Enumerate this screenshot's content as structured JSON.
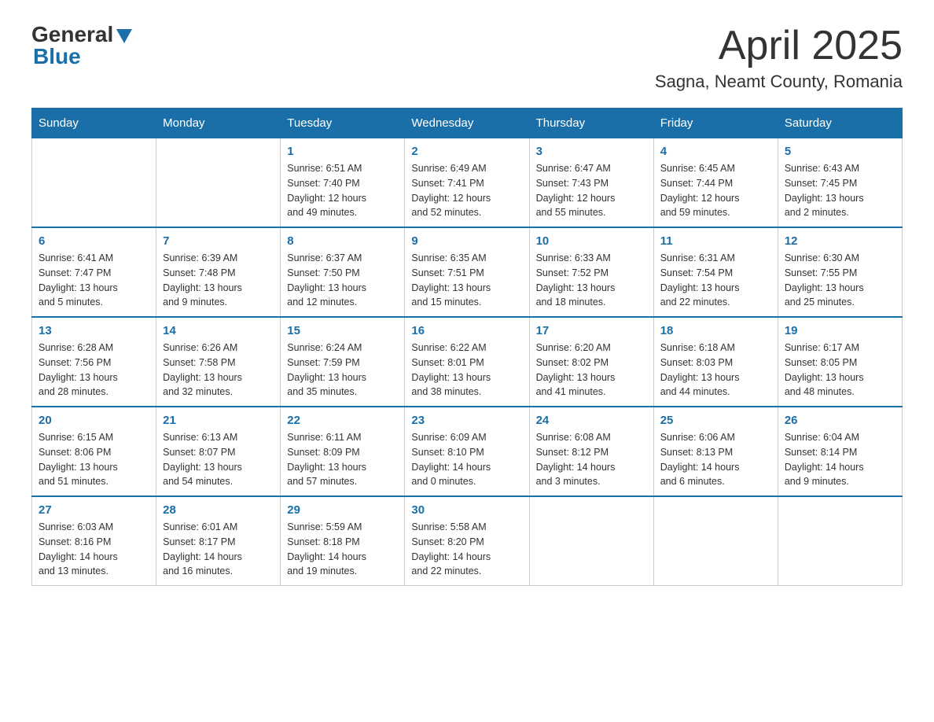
{
  "logo": {
    "general": "General",
    "blue": "Blue"
  },
  "title": "April 2025",
  "subtitle": "Sagna, Neamt County, Romania",
  "days_of_week": [
    "Sunday",
    "Monday",
    "Tuesday",
    "Wednesday",
    "Thursday",
    "Friday",
    "Saturday"
  ],
  "weeks": [
    [
      {
        "day": "",
        "info": ""
      },
      {
        "day": "",
        "info": ""
      },
      {
        "day": "1",
        "info": "Sunrise: 6:51 AM\nSunset: 7:40 PM\nDaylight: 12 hours\nand 49 minutes."
      },
      {
        "day": "2",
        "info": "Sunrise: 6:49 AM\nSunset: 7:41 PM\nDaylight: 12 hours\nand 52 minutes."
      },
      {
        "day": "3",
        "info": "Sunrise: 6:47 AM\nSunset: 7:43 PM\nDaylight: 12 hours\nand 55 minutes."
      },
      {
        "day": "4",
        "info": "Sunrise: 6:45 AM\nSunset: 7:44 PM\nDaylight: 12 hours\nand 59 minutes."
      },
      {
        "day": "5",
        "info": "Sunrise: 6:43 AM\nSunset: 7:45 PM\nDaylight: 13 hours\nand 2 minutes."
      }
    ],
    [
      {
        "day": "6",
        "info": "Sunrise: 6:41 AM\nSunset: 7:47 PM\nDaylight: 13 hours\nand 5 minutes."
      },
      {
        "day": "7",
        "info": "Sunrise: 6:39 AM\nSunset: 7:48 PM\nDaylight: 13 hours\nand 9 minutes."
      },
      {
        "day": "8",
        "info": "Sunrise: 6:37 AM\nSunset: 7:50 PM\nDaylight: 13 hours\nand 12 minutes."
      },
      {
        "day": "9",
        "info": "Sunrise: 6:35 AM\nSunset: 7:51 PM\nDaylight: 13 hours\nand 15 minutes."
      },
      {
        "day": "10",
        "info": "Sunrise: 6:33 AM\nSunset: 7:52 PM\nDaylight: 13 hours\nand 18 minutes."
      },
      {
        "day": "11",
        "info": "Sunrise: 6:31 AM\nSunset: 7:54 PM\nDaylight: 13 hours\nand 22 minutes."
      },
      {
        "day": "12",
        "info": "Sunrise: 6:30 AM\nSunset: 7:55 PM\nDaylight: 13 hours\nand 25 minutes."
      }
    ],
    [
      {
        "day": "13",
        "info": "Sunrise: 6:28 AM\nSunset: 7:56 PM\nDaylight: 13 hours\nand 28 minutes."
      },
      {
        "day": "14",
        "info": "Sunrise: 6:26 AM\nSunset: 7:58 PM\nDaylight: 13 hours\nand 32 minutes."
      },
      {
        "day": "15",
        "info": "Sunrise: 6:24 AM\nSunset: 7:59 PM\nDaylight: 13 hours\nand 35 minutes."
      },
      {
        "day": "16",
        "info": "Sunrise: 6:22 AM\nSunset: 8:01 PM\nDaylight: 13 hours\nand 38 minutes."
      },
      {
        "day": "17",
        "info": "Sunrise: 6:20 AM\nSunset: 8:02 PM\nDaylight: 13 hours\nand 41 minutes."
      },
      {
        "day": "18",
        "info": "Sunrise: 6:18 AM\nSunset: 8:03 PM\nDaylight: 13 hours\nand 44 minutes."
      },
      {
        "day": "19",
        "info": "Sunrise: 6:17 AM\nSunset: 8:05 PM\nDaylight: 13 hours\nand 48 minutes."
      }
    ],
    [
      {
        "day": "20",
        "info": "Sunrise: 6:15 AM\nSunset: 8:06 PM\nDaylight: 13 hours\nand 51 minutes."
      },
      {
        "day": "21",
        "info": "Sunrise: 6:13 AM\nSunset: 8:07 PM\nDaylight: 13 hours\nand 54 minutes."
      },
      {
        "day": "22",
        "info": "Sunrise: 6:11 AM\nSunset: 8:09 PM\nDaylight: 13 hours\nand 57 minutes."
      },
      {
        "day": "23",
        "info": "Sunrise: 6:09 AM\nSunset: 8:10 PM\nDaylight: 14 hours\nand 0 minutes."
      },
      {
        "day": "24",
        "info": "Sunrise: 6:08 AM\nSunset: 8:12 PM\nDaylight: 14 hours\nand 3 minutes."
      },
      {
        "day": "25",
        "info": "Sunrise: 6:06 AM\nSunset: 8:13 PM\nDaylight: 14 hours\nand 6 minutes."
      },
      {
        "day": "26",
        "info": "Sunrise: 6:04 AM\nSunset: 8:14 PM\nDaylight: 14 hours\nand 9 minutes."
      }
    ],
    [
      {
        "day": "27",
        "info": "Sunrise: 6:03 AM\nSunset: 8:16 PM\nDaylight: 14 hours\nand 13 minutes."
      },
      {
        "day": "28",
        "info": "Sunrise: 6:01 AM\nSunset: 8:17 PM\nDaylight: 14 hours\nand 16 minutes."
      },
      {
        "day": "29",
        "info": "Sunrise: 5:59 AM\nSunset: 8:18 PM\nDaylight: 14 hours\nand 19 minutes."
      },
      {
        "day": "30",
        "info": "Sunrise: 5:58 AM\nSunset: 8:20 PM\nDaylight: 14 hours\nand 22 minutes."
      },
      {
        "day": "",
        "info": ""
      },
      {
        "day": "",
        "info": ""
      },
      {
        "day": "",
        "info": ""
      }
    ]
  ]
}
